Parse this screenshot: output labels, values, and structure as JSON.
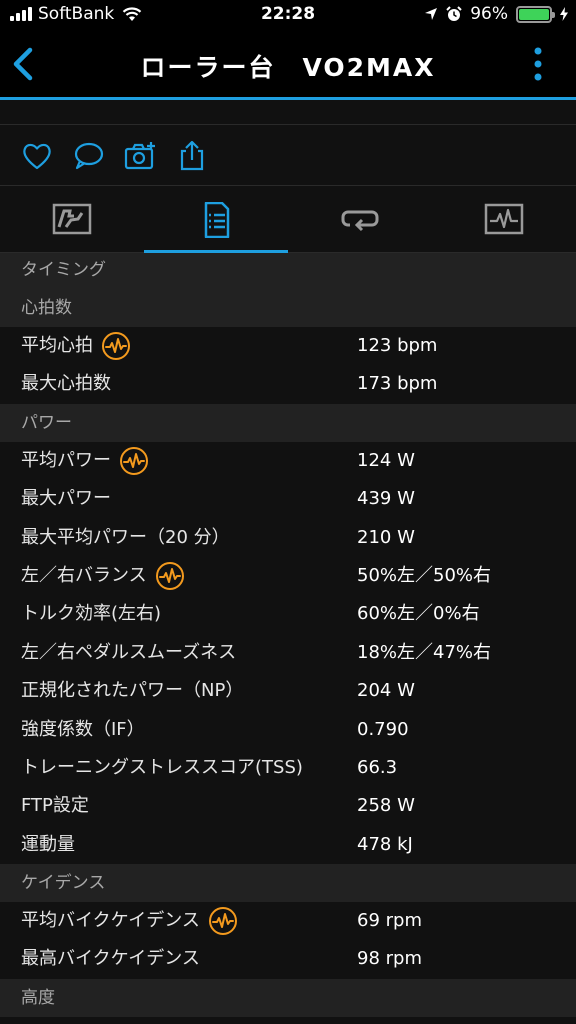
{
  "status": {
    "carrier": "SoftBank",
    "time": "22:28",
    "battery": "96%"
  },
  "nav": {
    "title": "ローラー台　VO2MAX"
  },
  "colors": {
    "accent": "#1e9fe0",
    "highlight": "#f39a1e",
    "battery": "#3ed359"
  },
  "actions": [
    "heart-icon",
    "comment-icon",
    "add-photo-icon",
    "share-icon"
  ],
  "tabs": [
    "map-tab",
    "stats-tab",
    "laps-tab",
    "chart-tab"
  ],
  "stats": {
    "timing": "タイミング",
    "hr": {
      "header": "心拍数",
      "rows": [
        {
          "label": "平均心拍",
          "value": "123 bpm"
        },
        {
          "label": "最大心拍数",
          "value": "173 bpm"
        }
      ]
    },
    "power": {
      "header": "パワー",
      "rows": [
        {
          "label": "平均パワー",
          "value": "124 W"
        },
        {
          "label": "最大パワー",
          "value": "439 W"
        },
        {
          "label": "最大平均パワー（20 分）",
          "value": "210 W"
        },
        {
          "label": "左／右バランス",
          "value": "50%左／50%右"
        },
        {
          "label": "トルク効率(左右)",
          "value": "60%左／0%右"
        },
        {
          "label": "左／右ペダルスムーズネス",
          "value": "18%左／47%右"
        },
        {
          "label": "正規化されたパワー（NP）",
          "value": "204 W"
        },
        {
          "label": "強度係数（IF）",
          "value": "0.790"
        },
        {
          "label": "トレーニングストレススコア(TSS)",
          "value": "66.3"
        },
        {
          "label": "FTP設定",
          "value": "258 W"
        },
        {
          "label": "運動量",
          "value": "478 kJ"
        }
      ]
    },
    "cadence": {
      "header": "ケイデンス",
      "rows": [
        {
          "label": "平均バイクケイデンス",
          "value": "69 rpm"
        },
        {
          "label": "最高バイクケイデンス",
          "value": "98 rpm"
        }
      ]
    },
    "elevation": {
      "header": "高度"
    }
  }
}
